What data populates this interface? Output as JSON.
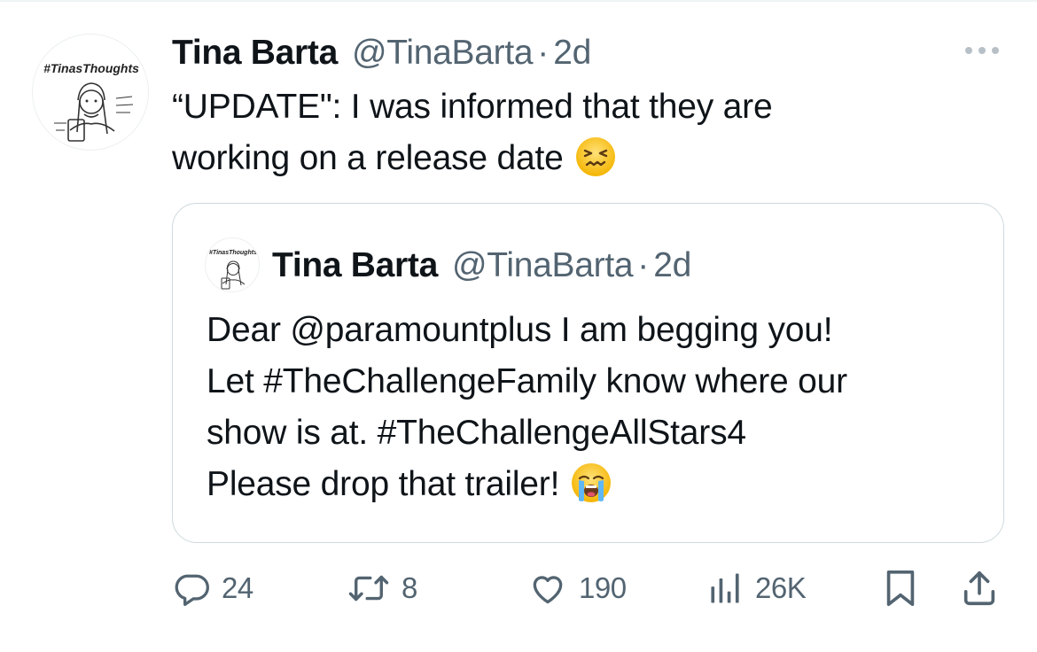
{
  "avatar_label": "#TinasThoughts",
  "tweet": {
    "author_name": "Tina Barta",
    "author_handle": "@TinaBarta",
    "separator": "·",
    "time": "2d",
    "text_lines": [
      "“UPDATE\": I was informed that they are",
      "working on a release date"
    ],
    "emoji": "confounded-face"
  },
  "quoted_tweet": {
    "avatar_label": "#TinasThoughts",
    "author_name": "Tina Barta",
    "author_handle": "@TinaBarta",
    "separator": "·",
    "time": "2d",
    "text_lines": [
      "Dear @paramountplus I am begging you!",
      "Let #TheChallengeFamily know where our",
      "show is at. #TheChallengeAllStars4",
      "Please drop that trailer!"
    ],
    "emoji": "loudly-crying-face"
  },
  "actions": {
    "replies": "24",
    "reposts": "8",
    "likes": "190",
    "views": "26K"
  },
  "colors": {
    "text": "#0f1419",
    "secondary": "#536471",
    "border": "#cfd9de"
  }
}
